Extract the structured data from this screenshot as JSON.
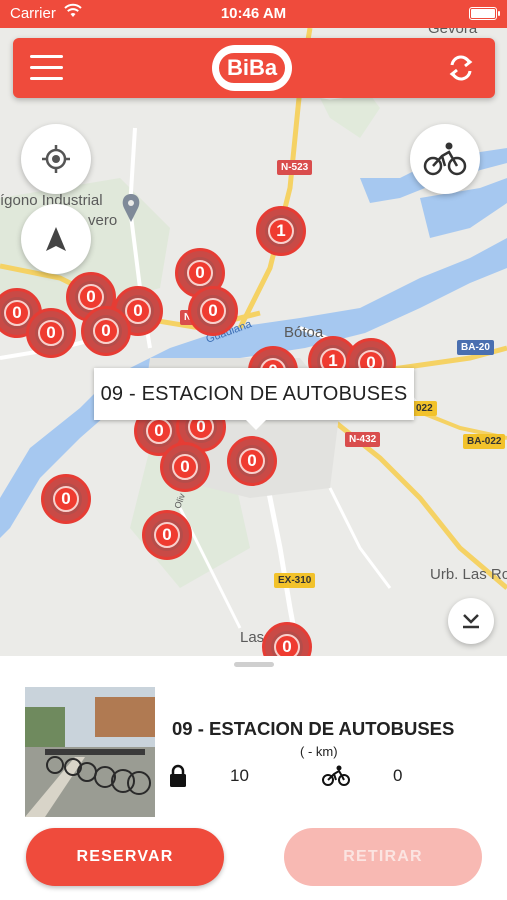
{
  "status_bar": {
    "carrier": "Carrier",
    "time": "10:46 AM"
  },
  "app_bar": {
    "logo_text": "BiBa"
  },
  "map": {
    "labels": {
      "gevora": "Gevora",
      "poligono": "ígono Industrial",
      "poligono2": "vero",
      "botoa": "Bótoa",
      "guadiana": "Guadiana",
      "urb_las_rozas": "Urb. Las Ro",
      "las_vaguadas": "Las      das",
      "olivo": "Oliv"
    },
    "roads": {
      "n523": "N-523",
      "n432": "N-432",
      "ba20": "BA-20",
      "ba022": "BA-022",
      "ex310": "EX-310",
      "r022": "022",
      "n_small": "N"
    },
    "markers": [
      "1",
      "0",
      "0",
      "0",
      "0",
      "0",
      "0",
      "0",
      "1",
      "0",
      "0",
      "0",
      "0",
      "0",
      "0",
      "0",
      "0",
      "0"
    ],
    "tooltip": "09 - ESTACION DE AUTOBUSES"
  },
  "sheet": {
    "station_name": "09 - ESTACION DE AUTOBUSES",
    "distance": "( - km)",
    "locks": "10",
    "bikes": "0",
    "reserve_label": "RESERVAR",
    "withdraw_label": "RETIRAR"
  }
}
